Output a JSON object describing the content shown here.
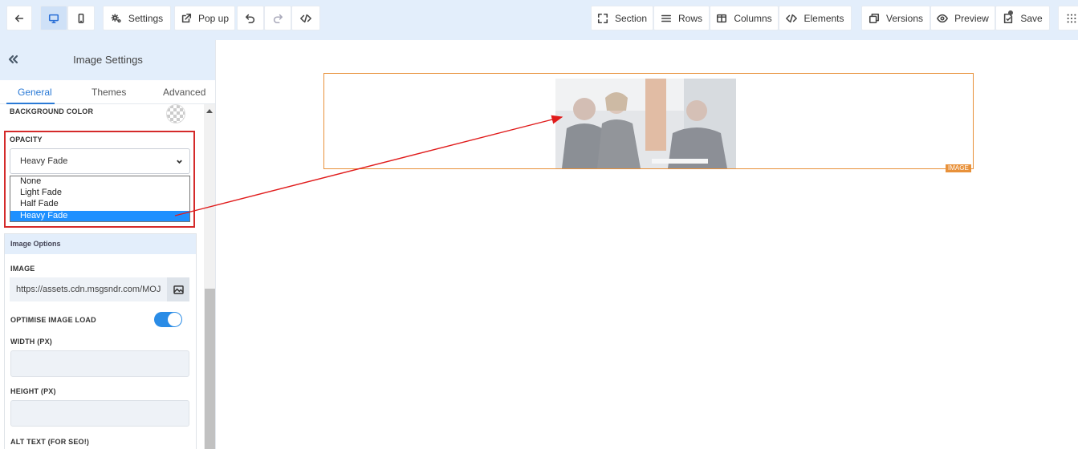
{
  "toolbar": {
    "settings_label": "Settings",
    "popup_label": "Pop up",
    "section_label": "Section",
    "rows_label": "Rows",
    "columns_label": "Columns",
    "elements_label": "Elements",
    "versions_label": "Versions",
    "preview_label": "Preview",
    "save_label": "Save"
  },
  "sidebar": {
    "title": "Image Settings",
    "tabs": [
      {
        "label": "General"
      },
      {
        "label": "Themes"
      },
      {
        "label": "Advanced"
      }
    ],
    "background_color_label": "BACKGROUND COLOR",
    "opacity": {
      "label": "OPACITY",
      "selected": "Heavy Fade",
      "options": [
        "None",
        "Light Fade",
        "Half Fade",
        "Heavy Fade"
      ]
    },
    "image_options": {
      "title": "Image Options",
      "image_label": "IMAGE",
      "image_url": "https://assets.cdn.msgsndr.com/MOJ",
      "optimise_label": "OPTIMISE IMAGE LOAD",
      "optimise_on": true,
      "width_label": "WIDTH (PX)",
      "width_value": "",
      "height_label": "HEIGHT (PX)",
      "height_value": "",
      "alt_label": "ALT TEXT (FOR SEO!)"
    }
  },
  "canvas": {
    "image_tag": "IMAGE"
  },
  "colors": {
    "accent": "#2a7ad6",
    "highlight": "#d42a2a",
    "element_outline": "#e8913a",
    "selected_option": "#1e90ff"
  }
}
